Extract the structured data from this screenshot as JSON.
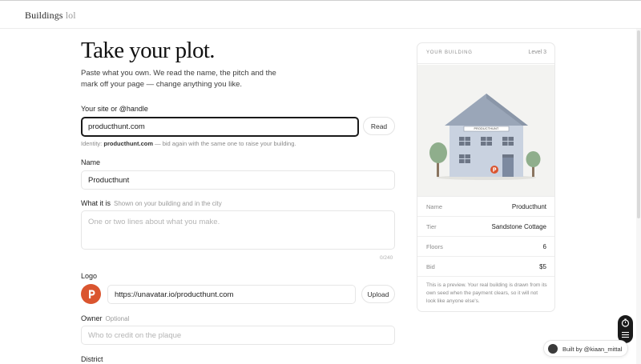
{
  "header": {
    "brand": "Buildings",
    "brand_suffix": "lol"
  },
  "page": {
    "title": "Take your plot.",
    "intro": "Paste what you own. We read the name, the pitch and the mark off your page — change anything you like."
  },
  "form": {
    "site": {
      "label": "Your site or @handle",
      "value": "producthunt.com",
      "read_button": "Read",
      "identity_prefix": "Identity:",
      "identity_value": "producthunt.com",
      "identity_suffix": "— bid again with the same one to raise your building."
    },
    "name": {
      "label": "Name",
      "value": "Producthunt"
    },
    "what": {
      "label": "What it is",
      "hint": "Shown on your building and in the city",
      "placeholder": "One or two lines about what you make.",
      "counter": "0/240"
    },
    "logo": {
      "label": "Logo",
      "letter": "P",
      "url": "https://unavatar.io/producthunt.com",
      "upload_button": "Upload"
    },
    "owner": {
      "label": "Owner",
      "hint": "Optional",
      "placeholder": "Who to credit on the plaque"
    },
    "district": {
      "label": "District"
    }
  },
  "card": {
    "heading": "YOUR BUILDING",
    "level": "Level 3",
    "sign": "PRODUCTHUNT",
    "rows": [
      {
        "key": "Name",
        "value": "Producthunt"
      },
      {
        "key": "Tier",
        "value": "Sandstone Cottage"
      },
      {
        "key": "Floors",
        "value": "6"
      },
      {
        "key": "Bid",
        "value": "$5"
      }
    ],
    "note": "This is a preview. Your real building is drawn from its own seed when the payment clears, so it will not look like anyone else's."
  },
  "footer": {
    "built_by": "Built by @kiaan_mittal"
  },
  "colors": {
    "accent": "#da552f",
    "ink": "#1a1a1a",
    "house_wall": "#c9d2e0",
    "roof": "#9aa6b8"
  }
}
